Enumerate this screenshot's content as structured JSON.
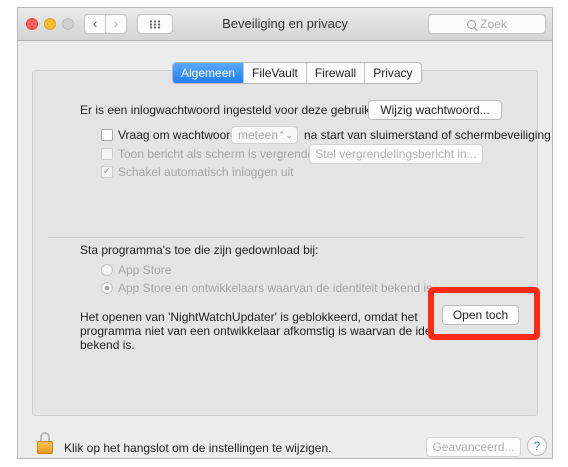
{
  "window": {
    "title": "Beveiliging en privacy"
  },
  "toolbar": {
    "back": "‹",
    "forward": "›",
    "search_placeholder": "Zoek"
  },
  "tabs": [
    {
      "label": "Algemeen",
      "active": true
    },
    {
      "label": "FileVault",
      "active": false
    },
    {
      "label": "Firewall",
      "active": false
    },
    {
      "label": "Privacy",
      "active": false
    }
  ],
  "login": {
    "text": "Er is een inlogwachtwoord ingesteld voor deze gebruiker",
    "change_button": "Wijzig wachtwoord..."
  },
  "require_password": {
    "label": "Vraag om wachtwoord",
    "select_value": "meteen",
    "suffix": "na start van sluimerstand of schermbeveiliging"
  },
  "show_message": {
    "label": "Toon bericht als scherm is vergrendeld",
    "button": "Stel vergrendelingsbericht in..."
  },
  "auto_login": {
    "label": "Schakel automatisch inloggen uit",
    "checked": true
  },
  "downloads": {
    "heading": "Sta programma's toe die zijn gedownload bij:",
    "options": [
      {
        "label": "App Store",
        "selected": false
      },
      {
        "label": "App Store en ontwikkelaars waarvan de identiteit bekend is",
        "selected": true
      }
    ],
    "blocked_lines": [
      "Het openen van 'NightWatchUpdater' is geblokkeerd, omdat het",
      "programma niet van een ontwikkelaar afkomstig is waarvan de identiteit",
      "bekend is."
    ],
    "open_anyway": "Open toch"
  },
  "footer": {
    "lock_text": "Klik op het hangslot om de instellingen te wijzigen.",
    "advanced": "Geavanceerd...",
    "help": "?"
  },
  "colors": {
    "highlight": "#ff2a16",
    "accent": "#1f7ff5"
  }
}
